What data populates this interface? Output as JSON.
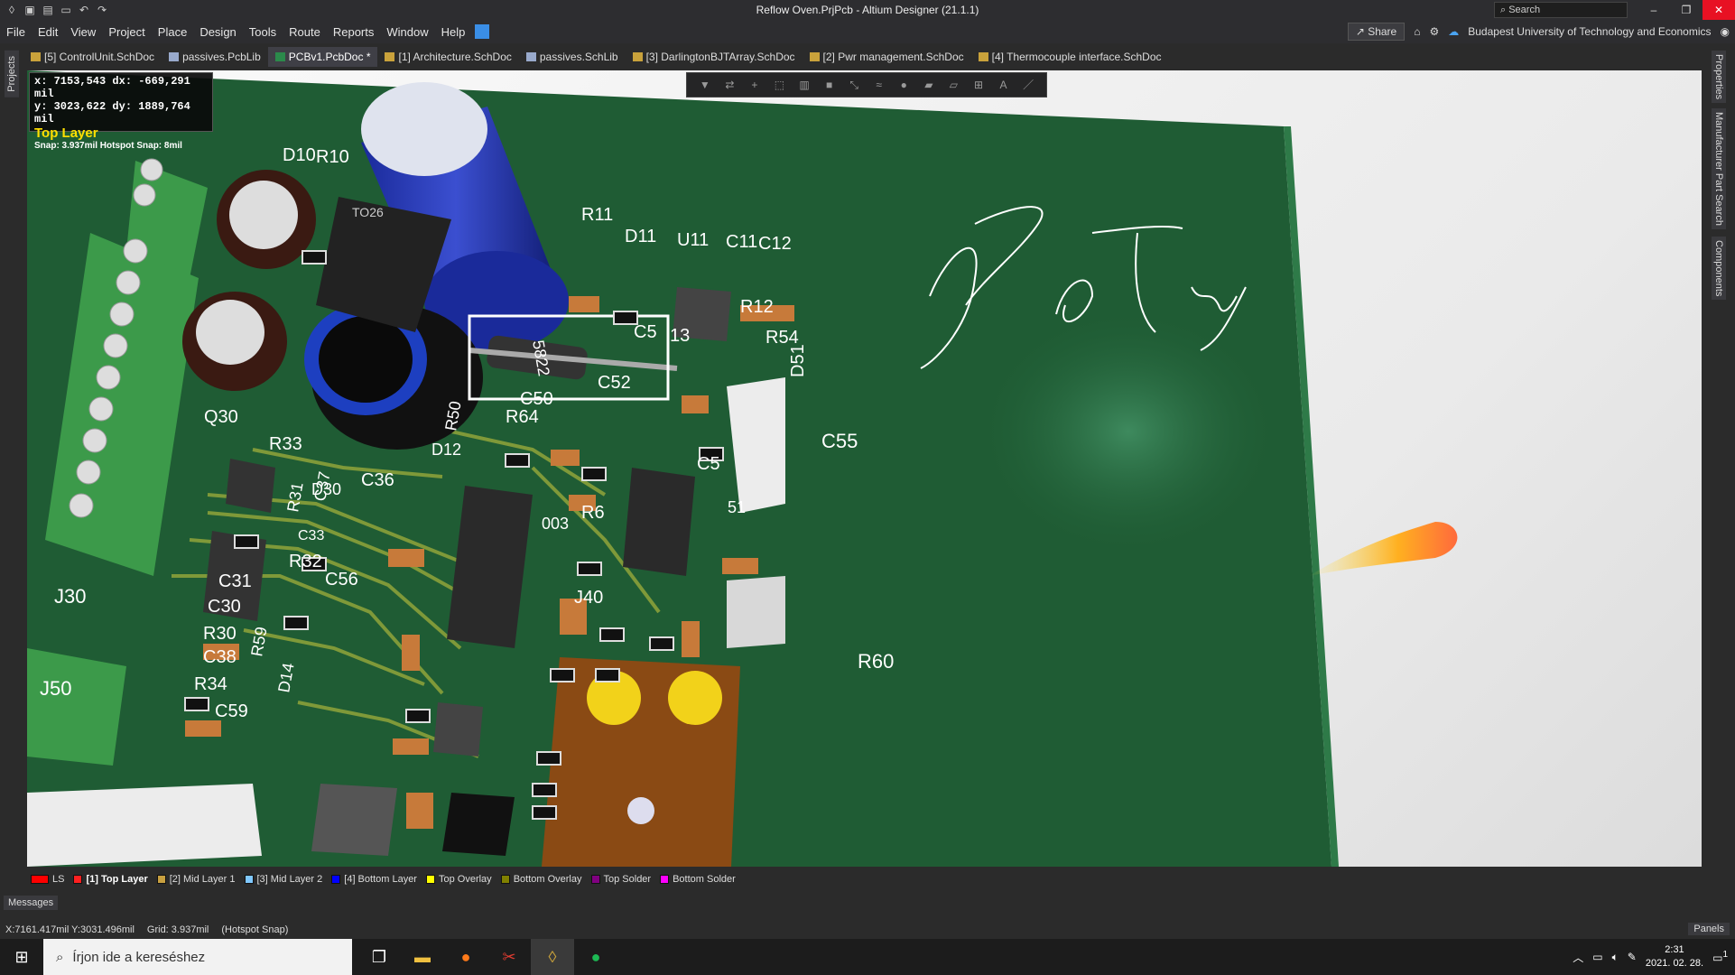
{
  "window": {
    "title": "Reflow Oven.PrjPcb - Altium Designer (21.1.1)",
    "search_placeholder": "Search",
    "min": "–",
    "restore": "❐",
    "close": "✕"
  },
  "menu": {
    "items": [
      "File",
      "Edit",
      "View",
      "Project",
      "Place",
      "Design",
      "Tools",
      "Route",
      "Reports",
      "Window",
      "Help"
    ],
    "share": "Share",
    "org": "Budapest University of Technology and Economics"
  },
  "tabs": [
    {
      "label": "[5] ControlUnit.SchDoc",
      "icon": "schematic-icon"
    },
    {
      "label": "passives.PcbLib",
      "icon": "library-icon"
    },
    {
      "label": "PCBv1.PcbDoc *",
      "icon": "pcb-icon",
      "active": true
    },
    {
      "label": "[1] Architecture.SchDoc",
      "icon": "schematic-icon"
    },
    {
      "label": "passives.SchLib",
      "icon": "library-icon"
    },
    {
      "label": "[3] DarlingtonBJTArray.SchDoc",
      "icon": "schematic-icon"
    },
    {
      "label": "[2] Pwr management.SchDoc",
      "icon": "schematic-icon"
    },
    {
      "label": "[4] Thermocouple interface.SchDoc",
      "icon": "schematic-icon"
    }
  ],
  "side_panels": {
    "left": "Projects",
    "right": [
      "Properties",
      "Manufacturer Part Search",
      "Components"
    ]
  },
  "hud": {
    "line1": "x:  7153,543   dx:  -669,291  mil",
    "line2": "y:  3023,622   dy:  1889,764  mil",
    "layer": "Top Layer",
    "snap": "Snap: 3.937mil Hotspot Snap: 8mil"
  },
  "designators": [
    "D10",
    "R10",
    "TO26",
    "R11",
    "D11",
    "U11",
    "C11",
    "C12",
    "R12",
    "C5",
    "13",
    "R54",
    "D51",
    "C52",
    "5822",
    "C50",
    "R50",
    "R64",
    "C55",
    "Q30",
    "R33",
    "R31",
    "C37",
    "C36",
    "D30",
    "D12",
    "C5",
    "R6",
    "C33",
    "C31",
    "R32",
    "C56",
    "J30",
    "C30",
    "R30",
    "C38",
    "R34",
    "C59",
    "J50",
    "R59",
    "D14",
    "J40",
    "R60",
    "003",
    "51"
  ],
  "layers": [
    {
      "label": "LS",
      "color": "#ff0000"
    },
    {
      "label": "[1] Top Layer",
      "color": "#ff2020",
      "active": true
    },
    {
      "label": "[2] Mid Layer 1",
      "color": "#c8a040"
    },
    {
      "label": "[3] Mid Layer 2",
      "color": "#80c8ff"
    },
    {
      "label": "[4] Bottom Layer",
      "color": "#0000ff"
    },
    {
      "label": "Top Overlay",
      "color": "#ffff00"
    },
    {
      "label": "Bottom Overlay",
      "color": "#808000"
    },
    {
      "label": "Top Solder",
      "color": "#800080"
    },
    {
      "label": "Bottom Solder",
      "color": "#ff00ff"
    }
  ],
  "messages": "Messages",
  "status": {
    "coords": "X:7161.417mil Y:3031.496mil",
    "grid": "Grid: 3.937mil",
    "snap": "(Hotspot Snap)",
    "panels": "Panels"
  },
  "taskbar": {
    "search": "Írjon ide a kereséshez",
    "time": "2:31",
    "date": "2021. 02. 28.",
    "notif_count": "1"
  },
  "colors": {
    "board": "#1f5c34",
    "silkscreen": "#ffffff",
    "trace": "#8aa03a"
  }
}
